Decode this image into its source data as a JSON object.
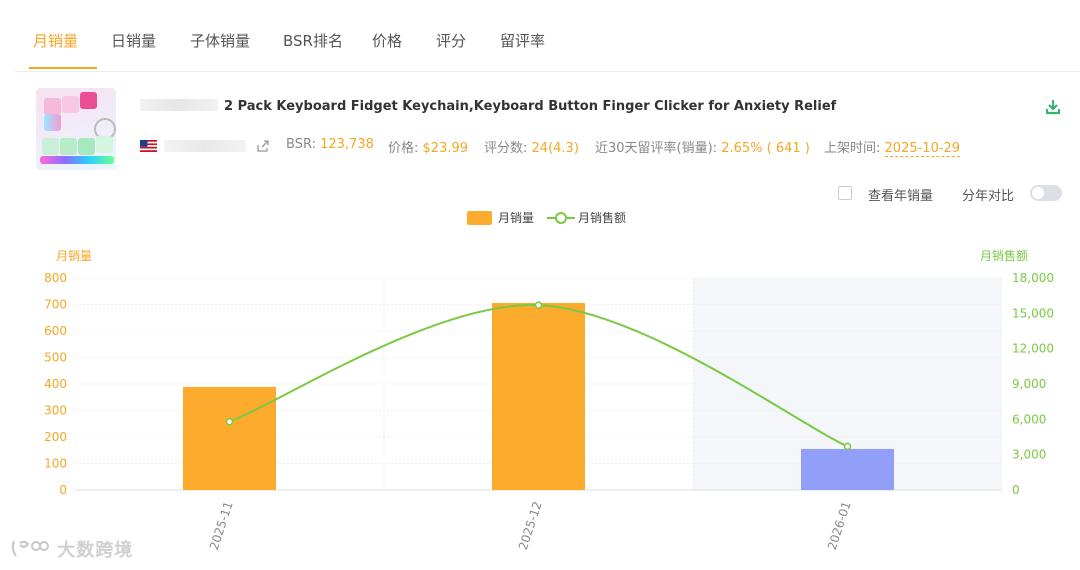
{
  "tabs": [
    "月销量",
    "日销量",
    "子体销量",
    "BSR排名",
    "价格",
    "评分",
    "留评率"
  ],
  "active_tab": "月销量",
  "product": {
    "title": "2 Pack Keyboard Fidget Keychain,Keyboard Button Finger Clicker for Anxiety Relief",
    "bsr_label": "BSR:",
    "bsr_value": "123,738",
    "price_label": "价格:",
    "price_value": "$23.99",
    "rating_label": "评分数:",
    "rating_value": "24(4.3)",
    "review_rate_label": "近30天留评率(销量):",
    "review_rate_value": "2.65% ( 641 )",
    "listed_label": "上架时间:",
    "listed_value": "2025-10-29",
    "marketplace_flag": "us-flag-icon"
  },
  "options": {
    "view_yearly_label": "查看年销量",
    "year_compare_label": "分年对比"
  },
  "colors": {
    "accent": "#f5a623",
    "bar": "#fdab2d",
    "bar_highlight": "#919ff8",
    "line": "#7ac943",
    "highlight_band": "#f5f6fa"
  },
  "chart_data": {
    "type": "bar",
    "categories": [
      "2025-11",
      "2025-12",
      "2026-01"
    ],
    "series": [
      {
        "name": "月销量",
        "type": "bar",
        "axis": "left",
        "values": [
          389,
          706,
          155
        ]
      },
      {
        "name": "月销售额",
        "type": "line",
        "axis": "right",
        "values": [
          5800,
          15700,
          3700
        ]
      }
    ],
    "ylabel_left": "月销量",
    "ylabel_right": "月销售额",
    "ylim_left": [
      0,
      800
    ],
    "ylim_right": [
      0,
      18000
    ],
    "yticks_left": [
      "0",
      "100",
      "200",
      "300",
      "400",
      "500",
      "600",
      "700",
      "800"
    ],
    "yticks_right": [
      "0",
      "3,000",
      "6,000",
      "9,000",
      "12,000",
      "15,000",
      "18,000"
    ],
    "highlighted_category": "2026-01",
    "legend_position": "top-center",
    "grid": true
  },
  "watermark": "大数跨境"
}
